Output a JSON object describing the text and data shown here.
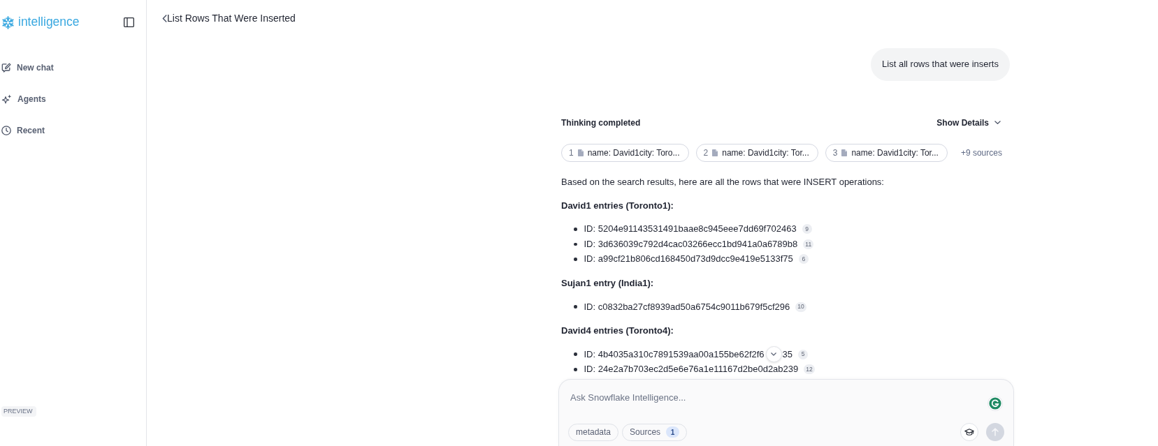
{
  "sidebar": {
    "logo": "intelligence",
    "items": [
      {
        "kind": "new-chat",
        "label": "New chat"
      },
      {
        "kind": "agents",
        "label": "Agents"
      },
      {
        "kind": "recent",
        "label": "Recent"
      }
    ],
    "badge": "PREVIEW"
  },
  "header": {
    "title": "List Rows That Were Inserted"
  },
  "conversation": {
    "user_message": "List all rows that were inserts",
    "thinking": {
      "status": "Thinking completed",
      "toggle": "Show Details",
      "expanded": false
    },
    "sources": [
      {
        "number": "1",
        "label": "name: David1city: Toro..."
      },
      {
        "number": "2",
        "label": "name: David1city: Tor..."
      },
      {
        "number": "3",
        "label": "name: David1city: Tor..."
      }
    ],
    "more_sources": "+9 sources",
    "answer": {
      "intro": "Based on the search results, here are all the rows that were INSERT operations:",
      "groups": [
        {
          "heading": "David1 entries (Toronto1):",
          "items": [
            {
              "text": "ID: 5204e91143531491baae8c945eee7dd69f702463",
              "ref": "9"
            },
            {
              "text": "ID: 3d636039c792d4cac03266ecc1bd941a0a6789b8",
              "ref": "11"
            },
            {
              "text": "ID: a99cf21b806cd168450d73d9dcc9e419e5133f75",
              "ref": "6"
            }
          ]
        },
        {
          "heading": "Sujan1 entry (India1):",
          "items": [
            {
              "text": "ID: c0832ba27cf8939ad50a6754c9011b679f5cf296",
              "ref": "10"
            }
          ]
        },
        {
          "heading": "David4 entries (Toronto4):",
          "items": [
            {
              "text": "ID: 4b4035a310c7891539aa00a155be62f2f6",
              "text_after_overlay": "35",
              "ref": "5"
            },
            {
              "text": "ID: 24e2a7b703ec2d5e6e76a1e11167d2be0d2ab239",
              "ref": "12"
            }
          ]
        }
      ]
    }
  },
  "composer": {
    "placeholder": "Ask Snowflake Intelligence...",
    "chips": [
      {
        "label": "metadata"
      },
      {
        "label": "Sources",
        "count": "1"
      }
    ]
  }
}
